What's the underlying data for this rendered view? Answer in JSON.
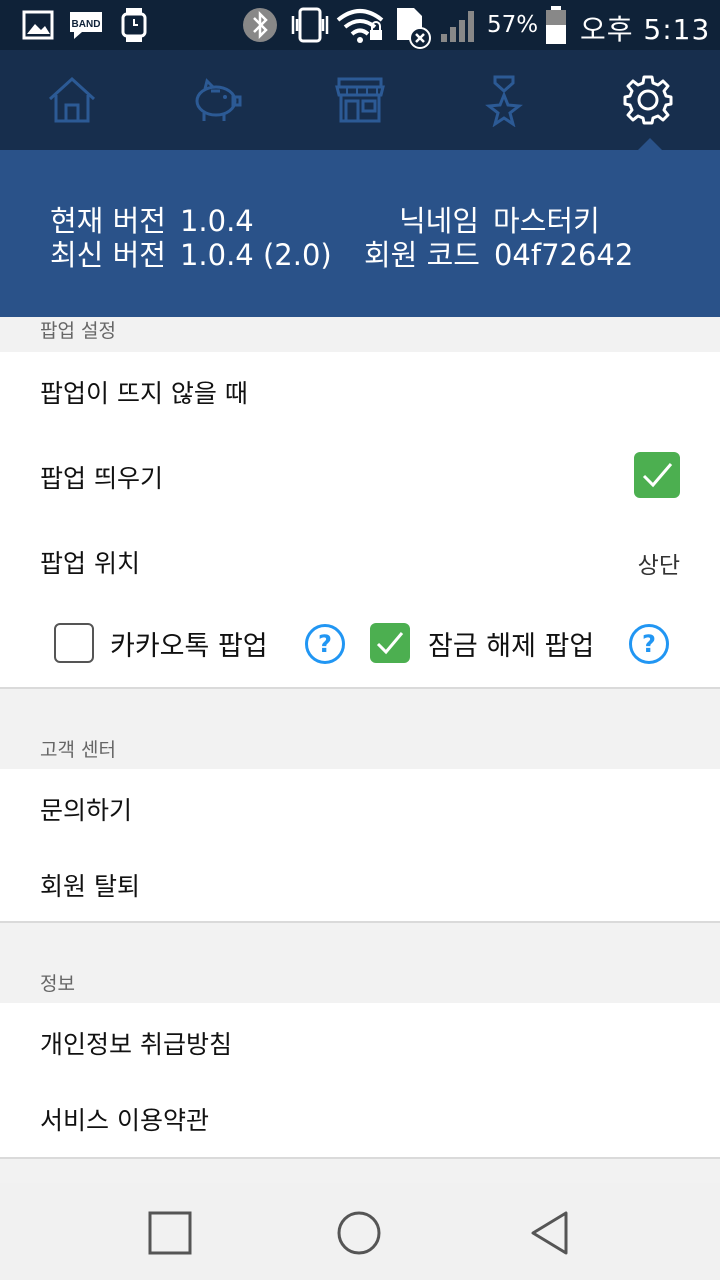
{
  "status_bar": {
    "battery": "57%",
    "time": "오후 5:13",
    "icons": [
      "gallery-icon",
      "band-icon",
      "watch-icon",
      "bluetooth-icon",
      "vibrate-icon",
      "wifi-icon",
      "sim-missing-icon",
      "signal-icon",
      "battery-icon"
    ],
    "band_text": "BAND"
  },
  "tabs": [
    {
      "name": "home-icon",
      "active": false
    },
    {
      "name": "piggy-bank-icon",
      "active": false
    },
    {
      "name": "store-icon",
      "active": false
    },
    {
      "name": "medal-icon",
      "active": false
    },
    {
      "name": "gear-icon",
      "active": true
    }
  ],
  "info": {
    "current_version_label": "현재 버전",
    "current_version_value": "1.0.4",
    "latest_version_label": "최신 버전",
    "latest_version_value": "1.0.4 (2.0)",
    "nickname_label": "닉네임",
    "nickname_value": "마스터키",
    "member_code_label": "회원 코드",
    "member_code_value": "04f72642"
  },
  "popup_section": {
    "header": "팝업 설정",
    "when_not_shown": "팝업이 뜨지 않을 때",
    "show_popup": "팝업 띄우기",
    "show_popup_checked": true,
    "popup_position": "팝업 위치",
    "popup_position_value": "상단",
    "kakao_popup": "카카오톡 팝업",
    "kakao_popup_checked": false,
    "unlock_popup": "잠금 해제 팝업",
    "unlock_popup_checked": true,
    "help_glyph": "?"
  },
  "support_section": {
    "header": "고객 센터",
    "inquiry": "문의하기",
    "withdraw": "회원 탈퇴"
  },
  "info_section": {
    "header": "정보",
    "privacy": "개인정보 취급방침",
    "terms": "서비스 이용약관"
  },
  "colors": {
    "tab_bar": "#172e4d",
    "info_panel": "#2a5289",
    "check": "#4caf50",
    "help": "#2196f3"
  }
}
